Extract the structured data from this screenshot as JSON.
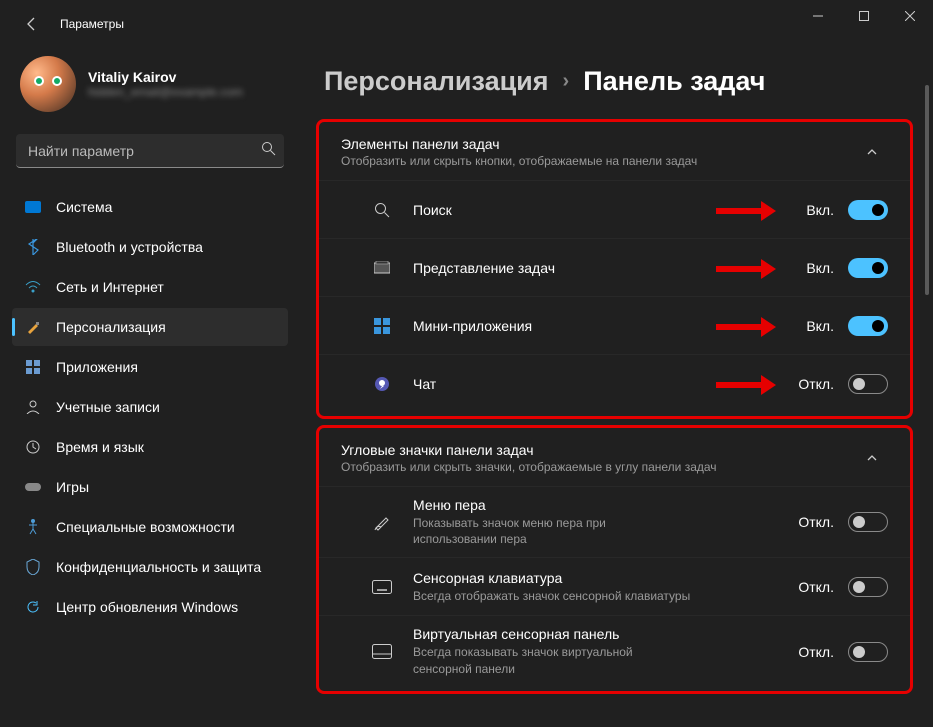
{
  "app_title": "Параметры",
  "profile": {
    "name": "Vitaliy Kairov",
    "email": "hidden_email@example.com"
  },
  "search": {
    "placeholder": "Найти параметр"
  },
  "nav": [
    {
      "id": "system",
      "label": "Система"
    },
    {
      "id": "bluetooth",
      "label": "Bluetooth и устройства"
    },
    {
      "id": "network",
      "label": "Сеть и Интернет"
    },
    {
      "id": "personalization",
      "label": "Персонализация"
    },
    {
      "id": "apps",
      "label": "Приложения"
    },
    {
      "id": "accounts",
      "label": "Учетные записи"
    },
    {
      "id": "time",
      "label": "Время и язык"
    },
    {
      "id": "gaming",
      "label": "Игры"
    },
    {
      "id": "accessibility",
      "label": "Специальные возможности"
    },
    {
      "id": "privacy",
      "label": "Конфиденциальность и защита"
    },
    {
      "id": "update",
      "label": "Центр обновления Windows"
    }
  ],
  "breadcrumb": {
    "parent": "Персонализация",
    "current": "Панель задач"
  },
  "group1": {
    "title": "Элементы панели задач",
    "subtitle": "Отобразить или скрыть кнопки, отображаемые на панели задач",
    "rows": [
      {
        "label": "Поиск",
        "state": "Вкл.",
        "on": true
      },
      {
        "label": "Представление задач",
        "state": "Вкл.",
        "on": true
      },
      {
        "label": "Мини-приложения",
        "state": "Вкл.",
        "on": true
      },
      {
        "label": "Чат",
        "state": "Откл.",
        "on": false
      }
    ]
  },
  "group2": {
    "title": "Угловые значки панели задач",
    "subtitle": "Отобразить или скрыть значки, отображаемые в углу панели задач",
    "rows": [
      {
        "label": "Меню пера",
        "desc": "Показывать значок меню пера при использовании пера",
        "state": "Откл.",
        "on": false
      },
      {
        "label": "Сенсорная клавиатура",
        "desc": "Всегда отображать значок сенсорной клавиатуры",
        "state": "Откл.",
        "on": false
      },
      {
        "label": "Виртуальная сенсорная панель",
        "desc": "Всегда показывать значок виртуальной сенсорной панели",
        "state": "Откл.",
        "on": false
      }
    ]
  }
}
